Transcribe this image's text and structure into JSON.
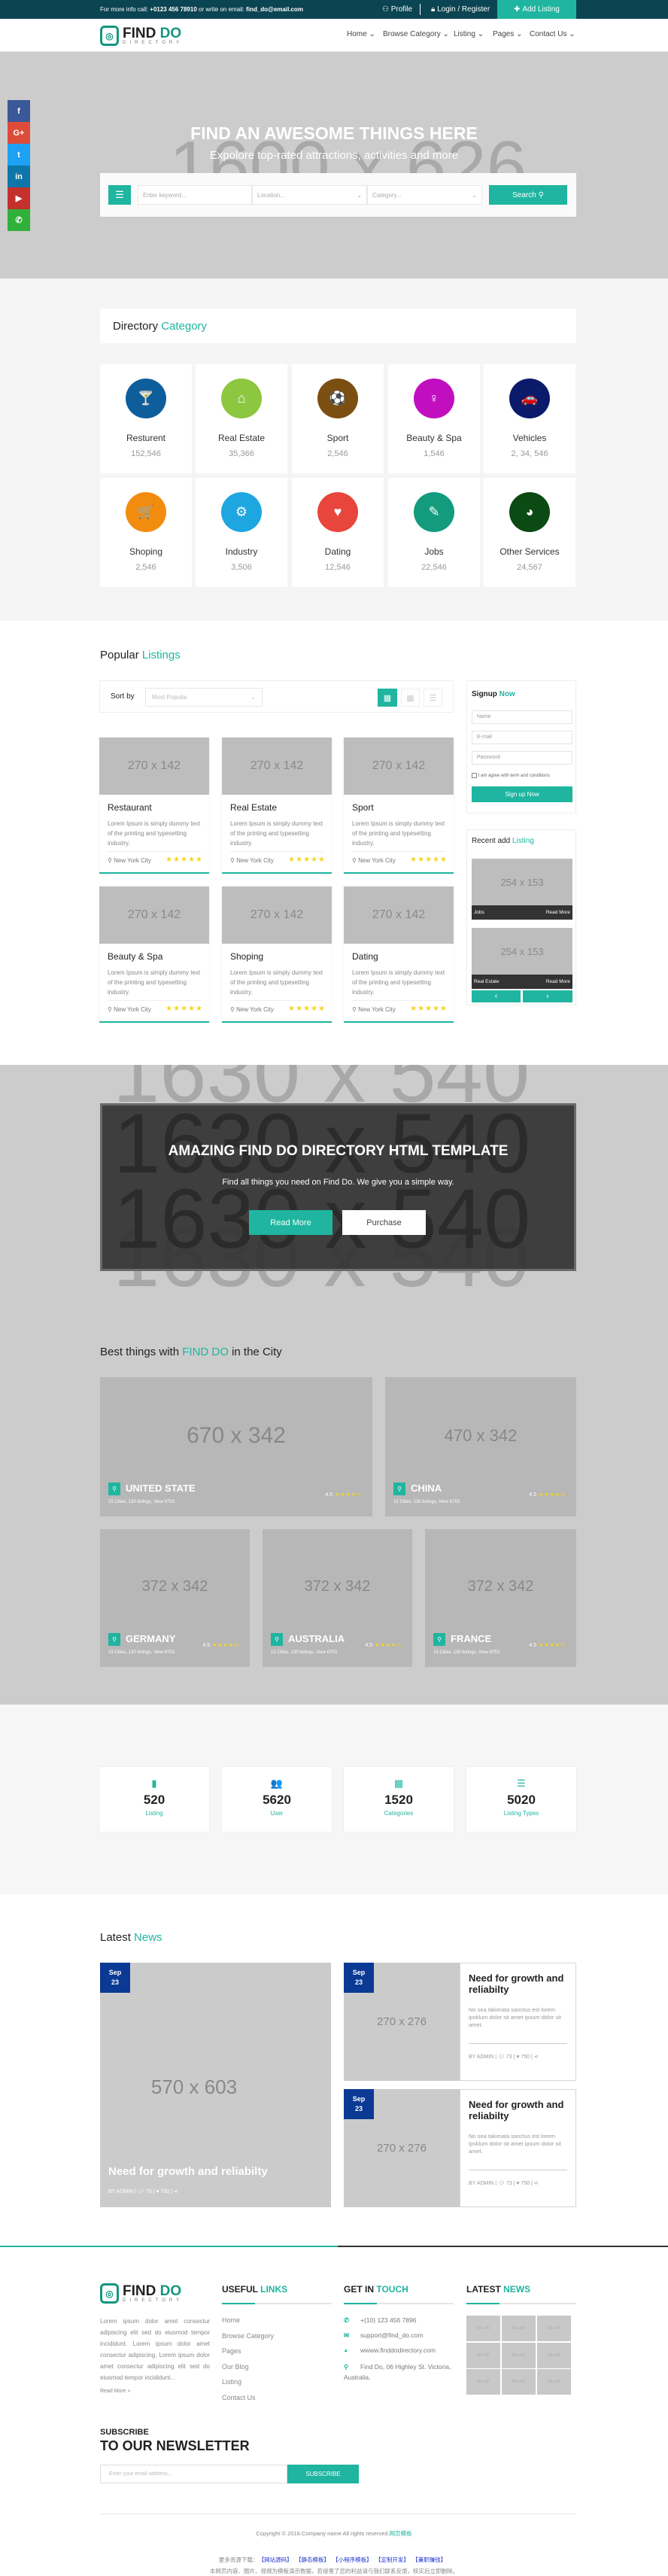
{
  "topbar": {
    "info_label": "For more info call:",
    "phone": "+0123 456 78910",
    "email_label": "or write on email:",
    "email": "find_do@email.com",
    "profile": "Profile",
    "login": "Login / Register",
    "add_listing": "Add Listing"
  },
  "brand": {
    "name_a": "FIND",
    "name_b": "DO",
    "tagline": "DIRECTORY",
    "accent": "#1fb5a0",
    "topbar_color": "#0b4452"
  },
  "nav": [
    {
      "label": "Home",
      "active": true
    },
    {
      "label": "Browse Category"
    },
    {
      "label": "Listing"
    },
    {
      "label": "Pages"
    },
    {
      "label": "Contact Us"
    }
  ],
  "hero": {
    "placeholder": "1600 x 626",
    "title": "FIND AN AWESOME THINGS HERE",
    "subtitle": "Expolore top-rated attractions, activities and more",
    "keyword_placeholder": "Enter keyword...",
    "location_placeholder": "Location...",
    "category_placeholder": "Category...",
    "search_label": "Search"
  },
  "social": [
    {
      "icon": "facebook-icon",
      "glyph": "f",
      "color": "#3b5998"
    },
    {
      "icon": "google-plus-icon",
      "glyph": "G+",
      "color": "#dd4b39"
    },
    {
      "icon": "twitter-icon",
      "glyph": "t",
      "color": "#1da1f2"
    },
    {
      "icon": "linkedin-icon",
      "glyph": "in",
      "color": "#0e76a8"
    },
    {
      "icon": "youtube-icon",
      "glyph": "▶",
      "color": "#c4302b"
    },
    {
      "icon": "whatsapp-icon",
      "glyph": "✆",
      "color": "#2fb13a"
    }
  ],
  "category": {
    "title_a": "Directory",
    "title_b": "Category",
    "items": [
      {
        "label": "Resturent",
        "count": "152,546",
        "color": "#0f5e9c",
        "icon": "cocktail-icon",
        "glyph": "🍸"
      },
      {
        "label": "Real Estate",
        "count": "35,366",
        "color": "#8dc63f",
        "icon": "home-icon",
        "glyph": "⌂"
      },
      {
        "label": "Sport",
        "count": "2,546",
        "color": "#7b4f12",
        "icon": "soccer-ball-icon",
        "glyph": "⚽"
      },
      {
        "label": "Beauty & Spa",
        "count": "1,546",
        "color": "#c10fbf",
        "icon": "female-icon",
        "glyph": "♀"
      },
      {
        "label": "Vehicles",
        "count": "2, 34, 546",
        "color": "#0c1a6b",
        "icon": "car-icon",
        "glyph": "🚗"
      },
      {
        "label": "Shoping",
        "count": "2,546",
        "color": "#f28c0f",
        "icon": "cart-icon",
        "glyph": "🛒"
      },
      {
        "label": "Industry",
        "count": "3,506",
        "color": "#1ea6e0",
        "icon": "gears-icon",
        "glyph": "⚙"
      },
      {
        "label": "Dating",
        "count": "12,546",
        "color": "#e8453c",
        "icon": "heart-icon",
        "glyph": "♥"
      },
      {
        "label": "Jobs",
        "count": "22,546",
        "color": "#139b7d",
        "icon": "edit-icon",
        "glyph": "✎"
      },
      {
        "label": "Other Services",
        "count": "24,567",
        "color": "#0b4a12",
        "icon": "globe-icon",
        "glyph": "◕"
      }
    ]
  },
  "listings": {
    "title_a": "Popular",
    "title_b": "Listings",
    "sort_label": "Sort by",
    "sort_value": "Most Popular",
    "cards": [
      {
        "title": "Restaurant",
        "image": "270 x 142",
        "desc": "Lorem Ipsum is simply dummy text of the printing and typesetting industry.",
        "location": "New York City",
        "rating": 5
      },
      {
        "title": "Real Estate",
        "image": "270 x 142",
        "desc": "Lorem Ipsum is simply dummy text of the printing and typesetting industry.",
        "location": "New York City",
        "rating": 5
      },
      {
        "title": "Sport",
        "image": "270 x 142",
        "desc": "Lorem Ipsum is simply dummy text of the printing and typesetting industry.",
        "location": "New York City",
        "rating": 5
      },
      {
        "title": "Beauty & Spa",
        "image": "270 x 142",
        "desc": "Lorem Ipsum is simply dummy text of the printing and typesetting industry.",
        "location": "New York City",
        "rating": 5
      },
      {
        "title": "Shoping",
        "image": "270 x 142",
        "desc": "Lorem Ipsum is simply dummy text of the printing and typesetting industry.",
        "location": "New York City",
        "rating": 5
      },
      {
        "title": "Dating",
        "image": "270 x 142",
        "desc": "Lorem Ipsum is simply dummy text of the printing and typesetting industry.",
        "location": "New York City",
        "rating": 5
      }
    ]
  },
  "signup": {
    "title_a": "Signup",
    "title_b": "Now",
    "name_ph": "Name",
    "email_ph": "E-mail",
    "password_ph": "Password",
    "agree": "I am agree with term and conditions",
    "button": "Sign up Now"
  },
  "recent": {
    "title_a": "Recent add",
    "title_b": "Listing",
    "items": [
      {
        "image": "254 x 153",
        "label": "Jobs",
        "link": "Read More"
      },
      {
        "image": "254 x 153",
        "label": "Real Estate",
        "link": "Read More"
      }
    ],
    "prev": "‹",
    "next": "›"
  },
  "cta": {
    "placeholder": "1630 x 540",
    "title": "AMAZING FIND DO DIRECTORY HTML TEMPLATE",
    "subtitle": "Find all things you need on Find Do. We give you a simple way.",
    "read_more": "Read More",
    "purchase": "Purchase"
  },
  "cities": {
    "title_a": "Best things with",
    "title_b": "FIND DO",
    "title_c": "in the City",
    "items": [
      {
        "name": "UNITED STATE",
        "image": "670 x 342",
        "meta": "15 Cities,  130 listings,  View 6753",
        "rating": "4.5"
      },
      {
        "name": "CHINA",
        "image": "470 x 342",
        "meta": "15 Cities,  130 listings,  View 6753",
        "rating": "4.5"
      },
      {
        "name": "GERMANY",
        "image": "372 x 342",
        "meta": "15 Cities,  130 listings,  View 6753",
        "rating": "4.5"
      },
      {
        "name": "AUSTRALIA",
        "image": "372 x 342",
        "meta": "15 Cities,  130 listings,  View 6753",
        "rating": "4.5"
      },
      {
        "name": "FRANCE",
        "image": "372 x 342",
        "meta": "15 Cities,  130 listings,  View 6753",
        "rating": "4.5"
      }
    ]
  },
  "stats": [
    {
      "value": "520",
      "label": "Listing",
      "icon": "file-icon",
      "glyph": "▮"
    },
    {
      "value": "5620",
      "label": "User",
      "icon": "users-icon",
      "glyph": "👥"
    },
    {
      "value": "1520",
      "label": "Categories",
      "icon": "grid-icon",
      "glyph": "▦"
    },
    {
      "value": "5020",
      "label": "Listing Types",
      "icon": "list-icon",
      "glyph": "☰"
    }
  ],
  "news": {
    "title_a": "Latest",
    "title_b": "News",
    "featured": {
      "month": "Sep",
      "day": "23",
      "image": "570 x 603",
      "title": "Need for growth and reliabilty",
      "author": "BY ADMIN",
      "comments": "73",
      "likes": "750"
    },
    "items": [
      {
        "month": "Sep",
        "day": "23",
        "image": "270 x 276",
        "title": "Need for growth and reliabilty",
        "desc": "No sea takimata sanctus est lorem ipsklum dolor sit amet ipsum dolor sit amet.",
        "author": "BY ADMIN",
        "comments": "73",
        "likes": "750"
      },
      {
        "month": "Sep",
        "day": "23",
        "image": "270 x 276",
        "title": "Need for growth and reliabilty",
        "desc": "No sea takimata sanctus est lorem ipsklum dolor sit amet ipsum dolor sit amet.",
        "author": "BY ADMIN",
        "comments": "73",
        "likes": "750"
      }
    ]
  },
  "footer": {
    "about": "Lorem ipsum dolor amet consectur adipiscing elit sed do eiusmod tempor incididunt. Lorem ipsum dolor amet consectur adipiscing, Lorem ipsum dolor amet consectur adipiscing elit sed do eiusmod tempor incididunt...",
    "read_more": "Read More",
    "links_title_a": "USEFUL",
    "links_title_b": "LINKS",
    "links": [
      "Home",
      "Browse Category",
      "Pages",
      "Our Blog",
      "Listing",
      "Contact Us"
    ],
    "touch_title_a": "GET IN",
    "touch_title_b": "TOUCH",
    "phone": "+(10) 123 456 7896",
    "email": "support@find_do.com",
    "website": "wwww.finddodirectory.com",
    "address": "Find Do, 06 Highley St. Victoria, Australia.",
    "news_title_a": "LATEST",
    "news_title_b": "NEWS",
    "thumb": "80 x 80",
    "subscribe_small": "SUBSCRIBE",
    "subscribe_big": "TO OUR NEWSLETTER",
    "email_ph": "Enter your email address...",
    "subscribe_btn": "SUBSCRIBE",
    "copyright": "Copyright © 2018.Company name All rights reserved.",
    "copyright_link": "网页模板",
    "more_label": "更多资源下载：",
    "more_links": [
      "【网站源码】",
      "【静态模板】",
      "【小程序模板】",
      "【定制开发】",
      "【兼职赚钱】"
    ],
    "disclaimer": "本网页内容、图片、视频为模板演示数据，若侵害了您的利益请与我们联系反馈，核实后立即删除。"
  }
}
